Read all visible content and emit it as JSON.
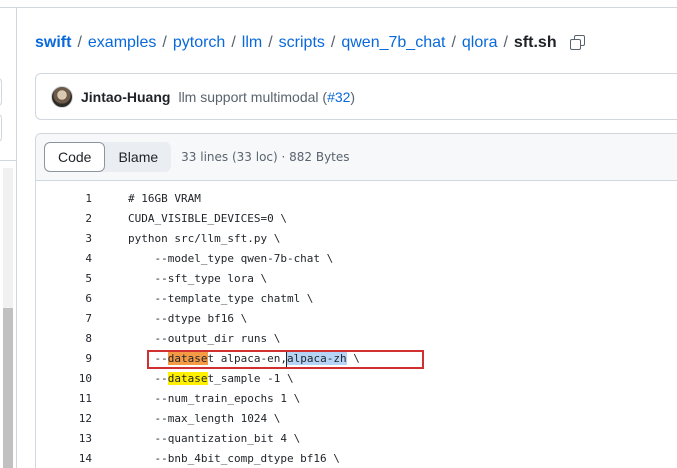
{
  "breadcrumb": {
    "items": [
      "swift",
      "examples",
      "pytorch",
      "llm",
      "scripts",
      "qwen_7b_chat",
      "qlora"
    ],
    "separator": "/",
    "file": "sft.sh"
  },
  "commit": {
    "author": "Jintao-Huang",
    "message": "llm support multimodal (",
    "pr": "#32",
    "message_end": ")"
  },
  "file_header": {
    "code_tab": "Code",
    "blame_tab": "Blame",
    "meta": "33 lines (33 loc) · 882 Bytes"
  },
  "code": {
    "lines": [
      {
        "n": "1",
        "text": "# 16GB VRAM"
      },
      {
        "n": "2",
        "text": "CUDA_VISIBLE_DEVICES=0 \\"
      },
      {
        "n": "3",
        "text": "python src/llm_sft.py \\"
      },
      {
        "n": "4",
        "text": "    --model_type qwen-7b-chat \\"
      },
      {
        "n": "5",
        "text": "    --sft_type lora \\"
      },
      {
        "n": "6",
        "text": "    --template_type chatml \\"
      },
      {
        "n": "7",
        "text": "    --dtype bf16 \\"
      },
      {
        "n": "8",
        "text": "    --output_dir runs \\"
      },
      {
        "n": "9",
        "pre": "    --",
        "hl": "datase",
        "mid": "t alpaca-en,",
        "sel": "alpaca-zh",
        "post": " \\"
      },
      {
        "n": "10",
        "pre": "    --",
        "hl": "datase",
        "post": "t_sample -1 \\"
      },
      {
        "n": "11",
        "text": "    --num_train_epochs 1 \\"
      },
      {
        "n": "12",
        "text": "    --max_length 1024 \\"
      },
      {
        "n": "13",
        "text": "    --quantization_bit 4 \\"
      },
      {
        "n": "14",
        "text": "    --bnb_4bit_comp_dtype bf16 \\"
      }
    ]
  },
  "colors": {
    "link": "#0969da",
    "highlight_search_current": "#f59a45",
    "highlight_search": "#ffef00",
    "selection": "#b6d4f5",
    "annotation_box": "#d0302f"
  }
}
